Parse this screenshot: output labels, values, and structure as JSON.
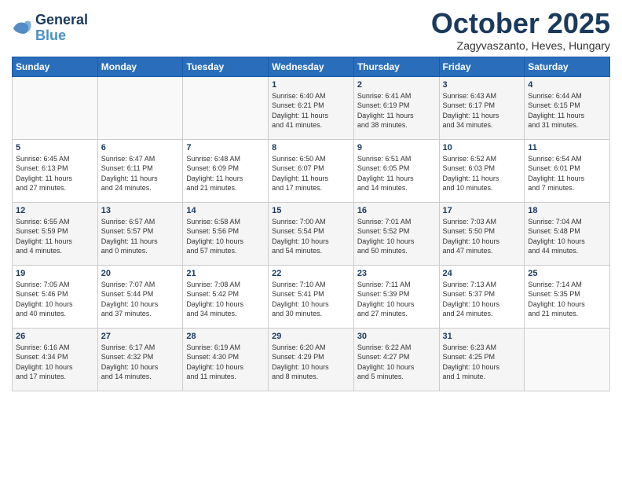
{
  "header": {
    "logo_line1": "General",
    "logo_line2": "Blue",
    "month": "October 2025",
    "location": "Zagyvaszanto, Heves, Hungary"
  },
  "days_of_week": [
    "Sunday",
    "Monday",
    "Tuesday",
    "Wednesday",
    "Thursday",
    "Friday",
    "Saturday"
  ],
  "weeks": [
    [
      {
        "day": "",
        "info": ""
      },
      {
        "day": "",
        "info": ""
      },
      {
        "day": "",
        "info": ""
      },
      {
        "day": "1",
        "info": "Sunrise: 6:40 AM\nSunset: 6:21 PM\nDaylight: 11 hours\nand 41 minutes."
      },
      {
        "day": "2",
        "info": "Sunrise: 6:41 AM\nSunset: 6:19 PM\nDaylight: 11 hours\nand 38 minutes."
      },
      {
        "day": "3",
        "info": "Sunrise: 6:43 AM\nSunset: 6:17 PM\nDaylight: 11 hours\nand 34 minutes."
      },
      {
        "day": "4",
        "info": "Sunrise: 6:44 AM\nSunset: 6:15 PM\nDaylight: 11 hours\nand 31 minutes."
      }
    ],
    [
      {
        "day": "5",
        "info": "Sunrise: 6:45 AM\nSunset: 6:13 PM\nDaylight: 11 hours\nand 27 minutes."
      },
      {
        "day": "6",
        "info": "Sunrise: 6:47 AM\nSunset: 6:11 PM\nDaylight: 11 hours\nand 24 minutes."
      },
      {
        "day": "7",
        "info": "Sunrise: 6:48 AM\nSunset: 6:09 PM\nDaylight: 11 hours\nand 21 minutes."
      },
      {
        "day": "8",
        "info": "Sunrise: 6:50 AM\nSunset: 6:07 PM\nDaylight: 11 hours\nand 17 minutes."
      },
      {
        "day": "9",
        "info": "Sunrise: 6:51 AM\nSunset: 6:05 PM\nDaylight: 11 hours\nand 14 minutes."
      },
      {
        "day": "10",
        "info": "Sunrise: 6:52 AM\nSunset: 6:03 PM\nDaylight: 11 hours\nand 10 minutes."
      },
      {
        "day": "11",
        "info": "Sunrise: 6:54 AM\nSunset: 6:01 PM\nDaylight: 11 hours\nand 7 minutes."
      }
    ],
    [
      {
        "day": "12",
        "info": "Sunrise: 6:55 AM\nSunset: 5:59 PM\nDaylight: 11 hours\nand 4 minutes."
      },
      {
        "day": "13",
        "info": "Sunrise: 6:57 AM\nSunset: 5:57 PM\nDaylight: 11 hours\nand 0 minutes."
      },
      {
        "day": "14",
        "info": "Sunrise: 6:58 AM\nSunset: 5:56 PM\nDaylight: 10 hours\nand 57 minutes."
      },
      {
        "day": "15",
        "info": "Sunrise: 7:00 AM\nSunset: 5:54 PM\nDaylight: 10 hours\nand 54 minutes."
      },
      {
        "day": "16",
        "info": "Sunrise: 7:01 AM\nSunset: 5:52 PM\nDaylight: 10 hours\nand 50 minutes."
      },
      {
        "day": "17",
        "info": "Sunrise: 7:03 AM\nSunset: 5:50 PM\nDaylight: 10 hours\nand 47 minutes."
      },
      {
        "day": "18",
        "info": "Sunrise: 7:04 AM\nSunset: 5:48 PM\nDaylight: 10 hours\nand 44 minutes."
      }
    ],
    [
      {
        "day": "19",
        "info": "Sunrise: 7:05 AM\nSunset: 5:46 PM\nDaylight: 10 hours\nand 40 minutes."
      },
      {
        "day": "20",
        "info": "Sunrise: 7:07 AM\nSunset: 5:44 PM\nDaylight: 10 hours\nand 37 minutes."
      },
      {
        "day": "21",
        "info": "Sunrise: 7:08 AM\nSunset: 5:42 PM\nDaylight: 10 hours\nand 34 minutes."
      },
      {
        "day": "22",
        "info": "Sunrise: 7:10 AM\nSunset: 5:41 PM\nDaylight: 10 hours\nand 30 minutes."
      },
      {
        "day": "23",
        "info": "Sunrise: 7:11 AM\nSunset: 5:39 PM\nDaylight: 10 hours\nand 27 minutes."
      },
      {
        "day": "24",
        "info": "Sunrise: 7:13 AM\nSunset: 5:37 PM\nDaylight: 10 hours\nand 24 minutes."
      },
      {
        "day": "25",
        "info": "Sunrise: 7:14 AM\nSunset: 5:35 PM\nDaylight: 10 hours\nand 21 minutes."
      }
    ],
    [
      {
        "day": "26",
        "info": "Sunrise: 6:16 AM\nSunset: 4:34 PM\nDaylight: 10 hours\nand 17 minutes."
      },
      {
        "day": "27",
        "info": "Sunrise: 6:17 AM\nSunset: 4:32 PM\nDaylight: 10 hours\nand 14 minutes."
      },
      {
        "day": "28",
        "info": "Sunrise: 6:19 AM\nSunset: 4:30 PM\nDaylight: 10 hours\nand 11 minutes."
      },
      {
        "day": "29",
        "info": "Sunrise: 6:20 AM\nSunset: 4:29 PM\nDaylight: 10 hours\nand 8 minutes."
      },
      {
        "day": "30",
        "info": "Sunrise: 6:22 AM\nSunset: 4:27 PM\nDaylight: 10 hours\nand 5 minutes."
      },
      {
        "day": "31",
        "info": "Sunrise: 6:23 AM\nSunset: 4:25 PM\nDaylight: 10 hours\nand 1 minute."
      },
      {
        "day": "",
        "info": ""
      }
    ]
  ]
}
